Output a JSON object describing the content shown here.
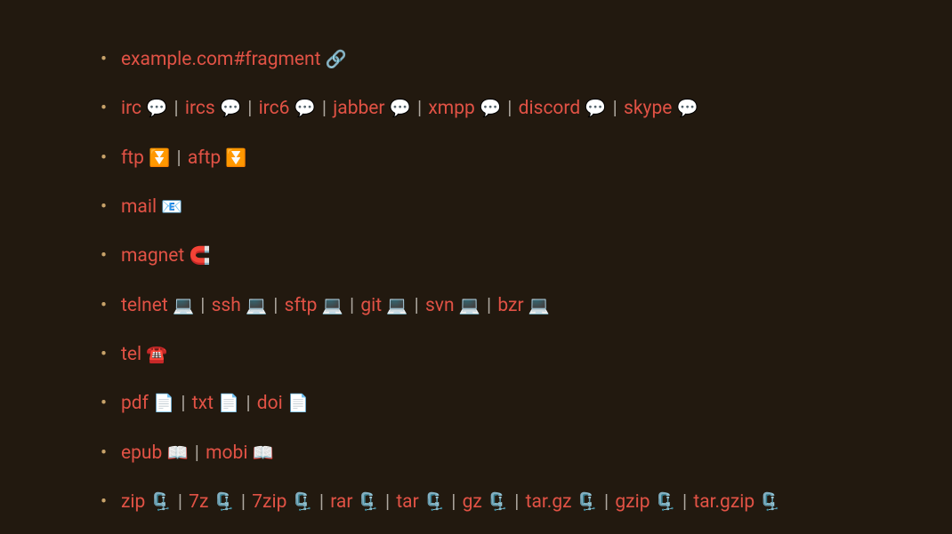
{
  "sep": "|",
  "icons": {
    "link": "🔗",
    "chat": "💬",
    "download": "⏬",
    "mail": "📧",
    "magnet": "🧲",
    "laptop": "💻",
    "tel": "☎️",
    "doc": "📄",
    "book": "📖",
    "clamp": "🗜️"
  },
  "rows": [
    {
      "items": [
        {
          "label": "example.com#fragment",
          "icon": "link"
        }
      ]
    },
    {
      "items": [
        {
          "label": "irc",
          "icon": "chat"
        },
        {
          "label": "ircs",
          "icon": "chat"
        },
        {
          "label": "irc6",
          "icon": "chat"
        },
        {
          "label": "jabber",
          "icon": "chat"
        },
        {
          "label": "xmpp",
          "icon": "chat"
        },
        {
          "label": "discord",
          "icon": "chat"
        },
        {
          "label": "skype",
          "icon": "chat"
        }
      ]
    },
    {
      "items": [
        {
          "label": "ftp",
          "icon": "download"
        },
        {
          "label": "aftp",
          "icon": "download"
        }
      ]
    },
    {
      "items": [
        {
          "label": "mail",
          "icon": "mail"
        }
      ]
    },
    {
      "items": [
        {
          "label": "magnet",
          "icon": "magnet"
        }
      ]
    },
    {
      "items": [
        {
          "label": "telnet",
          "icon": "laptop"
        },
        {
          "label": "ssh",
          "icon": "laptop"
        },
        {
          "label": "sftp",
          "icon": "laptop"
        },
        {
          "label": "git",
          "icon": "laptop"
        },
        {
          "label": "svn",
          "icon": "laptop"
        },
        {
          "label": "bzr",
          "icon": "laptop"
        }
      ]
    },
    {
      "items": [
        {
          "label": "tel",
          "icon": "tel"
        }
      ]
    },
    {
      "items": [
        {
          "label": "pdf",
          "icon": "doc"
        },
        {
          "label": "txt",
          "icon": "doc"
        },
        {
          "label": "doi",
          "icon": "doc"
        }
      ]
    },
    {
      "items": [
        {
          "label": "epub",
          "icon": "book"
        },
        {
          "label": "mobi",
          "icon": "book"
        }
      ]
    },
    {
      "items": [
        {
          "label": "zip",
          "icon": "clamp"
        },
        {
          "label": "7z",
          "icon": "clamp"
        },
        {
          "label": "7zip",
          "icon": "clamp"
        },
        {
          "label": "rar",
          "icon": "clamp"
        },
        {
          "label": "tar",
          "icon": "clamp"
        },
        {
          "label": "gz",
          "icon": "clamp"
        },
        {
          "label": "tar.gz",
          "icon": "clamp"
        },
        {
          "label": "gzip",
          "icon": "clamp"
        },
        {
          "label": "tar.gzip",
          "icon": "clamp"
        }
      ]
    }
  ]
}
